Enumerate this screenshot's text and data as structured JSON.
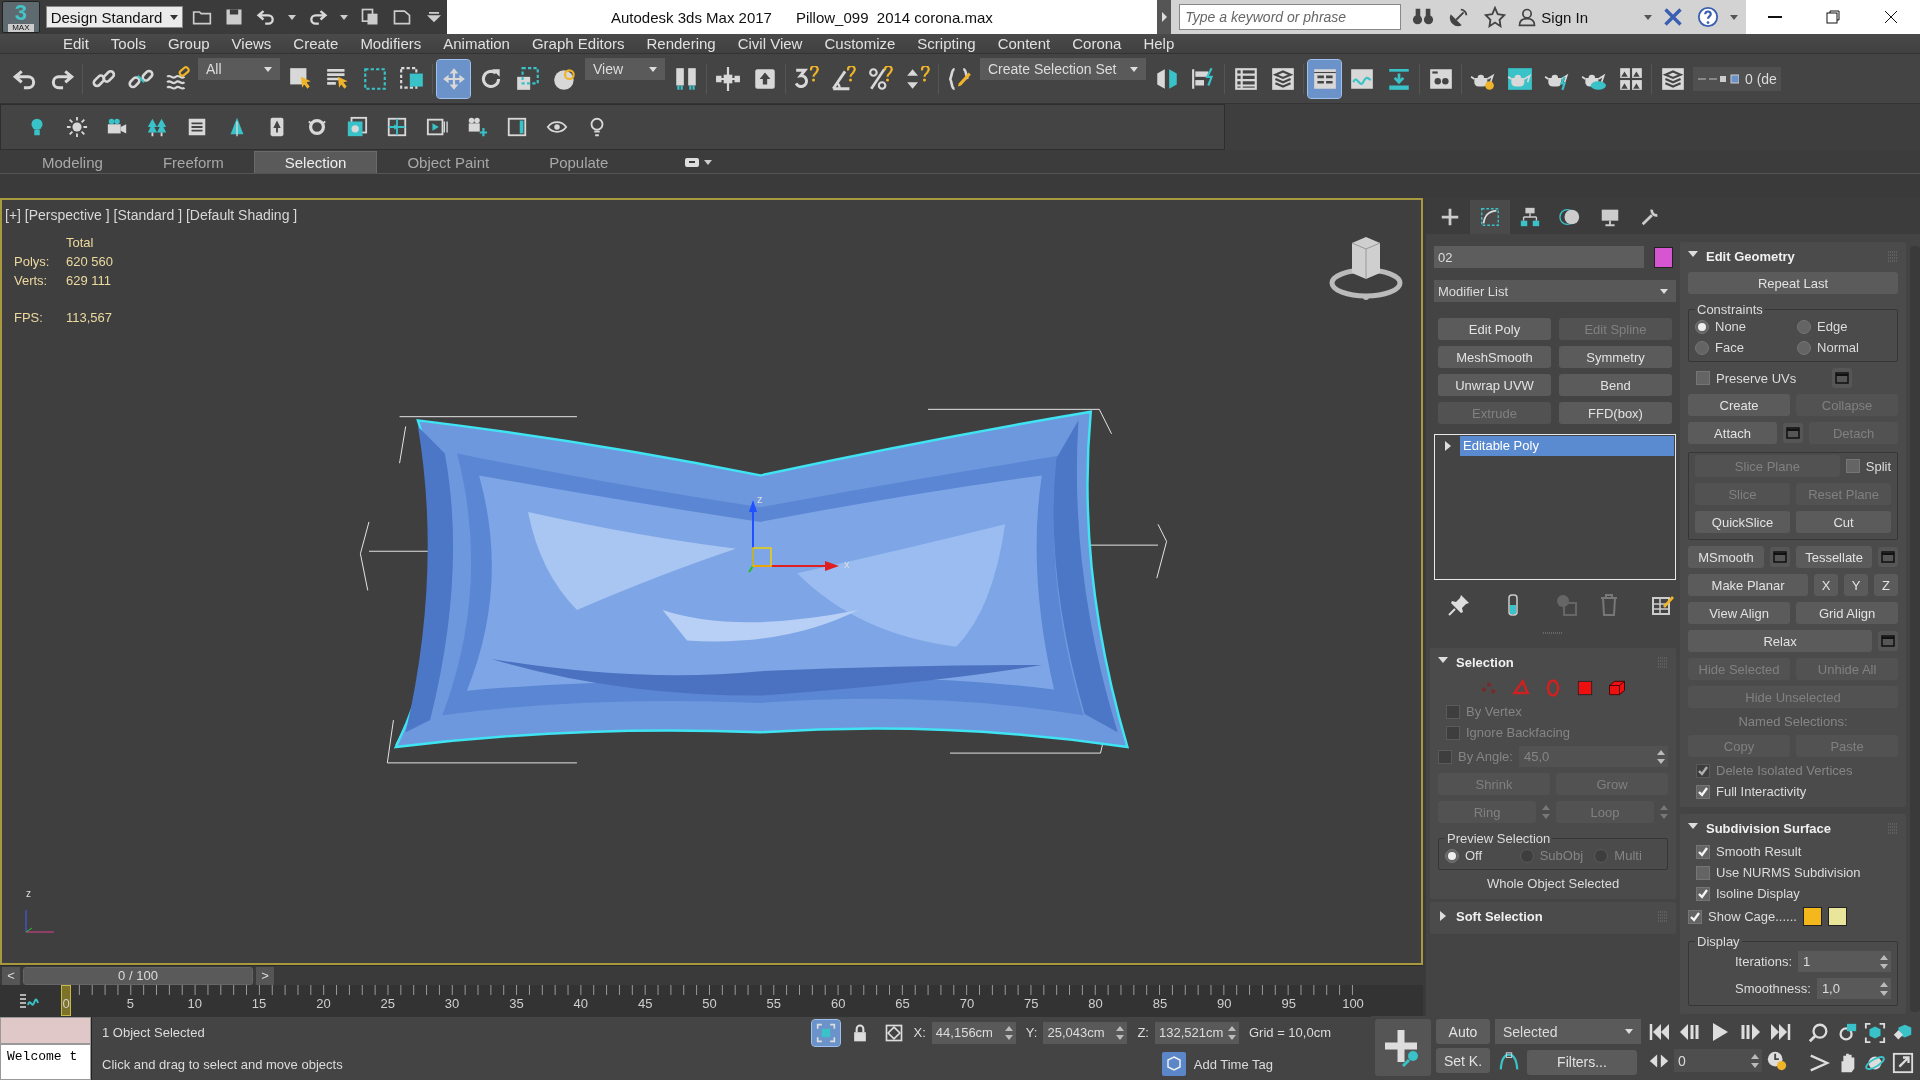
{
  "title_bar": {
    "logo": "3",
    "logo_caption": "MAX",
    "workspace": "Design Standard",
    "app": "Autodesk 3ds Max 2017",
    "file": "Pillow_099  2014 corona.max",
    "search_placeholder": "Type a keyword or phrase",
    "sign_in": "Sign In"
  },
  "menu": [
    "Edit",
    "Tools",
    "Group",
    "Views",
    "Create",
    "Modifiers",
    "Animation",
    "Graph Editors",
    "Rendering",
    "Civil View",
    "Customize",
    "Scripting",
    "Content",
    "Corona",
    "Help"
  ],
  "main_toolbar": [
    {
      "kind": "undo",
      "selected": false
    },
    {
      "kind": "redo",
      "selected": false
    },
    {
      "kind": "separator"
    },
    {
      "kind": "link",
      "selected": false
    },
    {
      "kind": "unlink",
      "selected": false
    },
    {
      "kind": "bind",
      "selected": false
    },
    {
      "kind": "dropdown",
      "label": "All"
    },
    {
      "kind": "select",
      "selected": false
    },
    {
      "kind": "select-name",
      "selected": false
    },
    {
      "kind": "rect-region",
      "selected": false
    },
    {
      "kind": "window-crossing",
      "selected": false
    },
    {
      "kind": "separator"
    },
    {
      "kind": "move",
      "selected": true
    },
    {
      "kind": "rotate",
      "selected": false
    },
    {
      "kind": "scale",
      "selected": false
    },
    {
      "kind": "place",
      "selected": false
    },
    {
      "kind": "dropdown",
      "label": "View"
    },
    {
      "kind": "pivot",
      "selected": false
    },
    {
      "kind": "separator"
    },
    {
      "kind": "manipulate",
      "selected": false
    },
    {
      "kind": "shortcut",
      "selected": false
    },
    {
      "kind": "separator"
    },
    {
      "kind": "snap",
      "selected": false
    },
    {
      "kind": "angle-snap",
      "selected": false
    },
    {
      "kind": "percent-snap",
      "selected": false
    },
    {
      "kind": "spinner-snap",
      "selected": false
    },
    {
      "kind": "separator"
    },
    {
      "kind": "named-sel",
      "selected": false
    },
    {
      "kind": "dropdown",
      "label": "Create Selection Set"
    },
    {
      "kind": "mirror",
      "selected": false
    },
    {
      "kind": "align",
      "selected": false
    },
    {
      "kind": "separator"
    },
    {
      "kind": "scene-explorer",
      "selected": false
    },
    {
      "kind": "layer-explorer",
      "selected": false
    },
    {
      "kind": "separator"
    },
    {
      "kind": "ribbon",
      "selected": true
    },
    {
      "kind": "curve-editor",
      "selected": false
    },
    {
      "kind": "schematic",
      "selected": false
    },
    {
      "kind": "separator"
    },
    {
      "kind": "material",
      "selected": false
    },
    {
      "kind": "separator"
    },
    {
      "kind": "render-setup",
      "selected": false
    },
    {
      "kind": "frame-window",
      "selected": false
    },
    {
      "kind": "render",
      "selected": false
    },
    {
      "kind": "cloud",
      "selected": false
    },
    {
      "kind": "a360",
      "selected": false
    },
    {
      "kind": "separator"
    },
    {
      "kind": "layers",
      "selected": false
    },
    {
      "kind": "layer-dropdown",
      "label": "0 (de"
    }
  ],
  "corona_toolbar": [
    {
      "kind": "light"
    },
    {
      "kind": "sun"
    },
    {
      "kind": "camera"
    },
    {
      "kind": "trees"
    },
    {
      "kind": "list"
    },
    {
      "kind": "tree"
    },
    {
      "kind": "card"
    },
    {
      "kind": "ring"
    },
    {
      "kind": "images"
    },
    {
      "kind": "frame"
    },
    {
      "kind": "play"
    },
    {
      "kind": "camera-plus"
    },
    {
      "kind": "panel"
    },
    {
      "kind": "eye"
    },
    {
      "kind": "bulb"
    }
  ],
  "ribbon_tabs": [
    {
      "label": "Modeling",
      "selected": false
    },
    {
      "label": "Freeform",
      "selected": false
    },
    {
      "label": "Selection",
      "selected": true
    },
    {
      "label": "Object Paint",
      "selected": false
    },
    {
      "label": "Populate",
      "selected": false
    }
  ],
  "viewport": {
    "label": "[+] [Perspective ] [Standard ] [Default Shading ]",
    "stats_header": "Total",
    "stats": [
      {
        "label": "Polys:",
        "value": "620 560"
      },
      {
        "label": "Verts:",
        "value": "629 111"
      }
    ],
    "fps": {
      "label": "FPS:",
      "value": "113,567"
    },
    "gizmo_labels": [
      "z",
      "x"
    ],
    "corner_axis_label": "z",
    "object": {
      "kind": "picture"
    }
  },
  "command_panel": {
    "tabs": [
      {
        "kind": "create",
        "selected": false
      },
      {
        "kind": "modify",
        "selected": true
      },
      {
        "kind": "hierarchy",
        "selected": false
      },
      {
        "kind": "motion",
        "selected": false
      },
      {
        "kind": "display",
        "selected": false
      },
      {
        "kind": "utilities",
        "selected": false
      }
    ],
    "object_name": "02",
    "object_swatch": {
      "color": "#d655d0"
    },
    "modifier_list": "Modifier List",
    "modifier_buttons": [
      {
        "label": "Edit Poly",
        "disabled": false
      },
      {
        "label": "Edit Spline",
        "disabled": true
      },
      {
        "label": "MeshSmooth",
        "disabled": false
      },
      {
        "label": "Symmetry",
        "disabled": false
      },
      {
        "label": "Unwrap UVW",
        "disabled": false
      },
      {
        "label": "Bend",
        "disabled": false
      },
      {
        "label": "Extrude",
        "disabled": true
      },
      {
        "label": "FFD(box)",
        "disabled": false
      }
    ],
    "stack": [
      {
        "label": "Editable Poly",
        "selected": true
      }
    ],
    "left_rollouts": [
      {
        "title": "Selection",
        "expanded": true,
        "items": [
          {
            "kind": "row",
            "cells": [
              {
                "kind": "vertex",
                "disabled": true
              },
              {
                "kind": "edge",
                "disabled": true
              },
              {
                "kind": "border",
                "disabled": true
              },
              {
                "kind": "polygon",
                "disabled": false
              },
              {
                "kind": "element",
                "disabled": false
              }
            ]
          },
          {
            "kind": "row",
            "cells": [
              {
                "kind": "checkbox",
                "label": "By Vertex",
                "checked": false,
                "disabled": true
              }
            ]
          },
          {
            "kind": "row",
            "cells": [
              {
                "kind": "checkbox",
                "label": "Ignore Backfacing",
                "checked": false,
                "disabled": true
              }
            ]
          },
          {
            "kind": "row",
            "cells": [
              {
                "kind": "checkbox",
                "label": "By Angle:",
                "checked": false,
                "disabled": true
              },
              {
                "kind": "spinner",
                "value": "45,0",
                "disabled": true
              }
            ]
          },
          {
            "kind": "row",
            "cells": [
              {
                "kind": "button",
                "label": "Shrink",
                "disabled": true
              },
              {
                "kind": "button",
                "label": "Grow",
                "disabled": true
              }
            ]
          },
          {
            "kind": "row",
            "cells": [
              {
                "kind": "button",
                "label": "Ring",
                "disabled": true,
                "stepper": true
              },
              {
                "kind": "button",
                "label": "Loop",
                "disabled": true,
                "stepper": true
              }
            ]
          },
          {
            "kind": "group",
            "title": "Preview Selection",
            "items": [
              {
                "kind": "radios",
                "options": [
                  {
                    "label": "Off",
                    "selected": true,
                    "disabled": false
                  },
                  {
                    "label": "SubObj",
                    "selected": false,
                    "disabled": true
                  },
                  {
                    "label": "Multi",
                    "selected": false,
                    "disabled": true
                  }
                ]
              }
            ]
          },
          {
            "kind": "row",
            "cells": [
              {
                "kind": "text",
                "text": "Whole Object Selected",
                "disabled": false
              }
            ]
          }
        ]
      },
      {
        "title": "Soft Selection",
        "expanded": false
      }
    ],
    "right_rollouts": [
      {
        "title": "Edit Geometry",
        "expanded": true,
        "items": [
          {
            "kind": "row",
            "cells": [
              {
                "kind": "button",
                "label": "Repeat Last",
                "disabled": false
              }
            ]
          },
          {
            "kind": "group",
            "title": "Constraints",
            "items": [
              {
                "kind": "radios",
                "options": [
                  {
                    "label": "None",
                    "selected": true,
                    "disabled": false
                  },
                  {
                    "label": "Edge",
                    "selected": false,
                    "disabled": false
                  },
                  {
                    "label": "Face",
                    "selected": false,
                    "disabled": false
                  },
                  {
                    "label": "Normal",
                    "selected": false,
                    "disabled": false
                  }
                ]
              }
            ]
          },
          {
            "kind": "row",
            "cells": [
              {
                "kind": "checkbox",
                "label": "Preserve UVs",
                "checked": false,
                "disabled": false,
                "options": true
              }
            ]
          },
          {
            "kind": "row",
            "cells": [
              {
                "kind": "button",
                "label": "Create",
                "disabled": false
              },
              {
                "kind": "button",
                "label": "Collapse",
                "disabled": true
              }
            ]
          },
          {
            "kind": "row",
            "cells": [
              {
                "kind": "button",
                "label": "Attach",
                "disabled": false,
                "options": true
              },
              {
                "kind": "button",
                "label": "Detach",
                "disabled": true
              }
            ]
          },
          {
            "kind": "group",
            "items": [
              {
                "kind": "row",
                "cells": [
                  {
                    "kind": "button",
                    "label": "Slice Plane",
                    "disabled": true
                  },
                  {
                    "kind": "checkbox",
                    "label": "Split",
                    "checked": false,
                    "disabled": false
                  }
                ]
              },
              {
                "kind": "row",
                "cells": [
                  {
                    "kind": "button",
                    "label": "Slice",
                    "disabled": true
                  },
                  {
                    "kind": "button",
                    "label": "Reset Plane",
                    "disabled": true
                  }
                ]
              },
              {
                "kind": "row",
                "cells": [
                  {
                    "kind": "button",
                    "label": "QuickSlice",
                    "disabled": false
                  },
                  {
                    "kind": "button",
                    "label": "Cut",
                    "disabled": false
                  }
                ]
              }
            ]
          },
          {
            "kind": "row",
            "cells": [
              {
                "kind": "button",
                "label": "MSmooth",
                "disabled": false,
                "options": true
              },
              {
                "kind": "button",
                "label": "Tessellate",
                "disabled": false,
                "options": true
              }
            ]
          },
          {
            "kind": "row",
            "cells": [
              {
                "kind": "button",
                "label": "Make Planar",
                "disabled": false
              },
              {
                "kind": "button",
                "label": "X",
                "disabled": false
              },
              {
                "kind": "button",
                "label": "Y",
                "disabled": false
              },
              {
                "kind": "button",
                "label": "Z",
                "disabled": false
              }
            ]
          },
          {
            "kind": "row",
            "cells": [
              {
                "kind": "button",
                "label": "View Align",
                "disabled": false
              },
              {
                "kind": "button",
                "label": "Grid Align",
                "disabled": false
              }
            ]
          },
          {
            "kind": "row",
            "cells": [
              {
                "kind": "button",
                "label": "Relax",
                "disabled": false,
                "options": true
              }
            ]
          },
          {
            "kind": "row",
            "cells": [
              {
                "kind": "button",
                "label": "Hide Selected",
                "disabled": true
              },
              {
                "kind": "button",
                "label": "Unhide All",
                "disabled": true
              }
            ]
          },
          {
            "kind": "row",
            "cells": [
              {
                "kind": "button",
                "label": "Hide Unselected",
                "disabled": true
              }
            ]
          },
          {
            "kind": "row",
            "cells": [
              {
                "kind": "text",
                "text": "Named Selections:",
                "disabled": true
              }
            ]
          },
          {
            "kind": "row",
            "cells": [
              {
                "kind": "button",
                "label": "Copy",
                "disabled": true
              },
              {
                "kind": "button",
                "label": "Paste",
                "disabled": true
              }
            ]
          },
          {
            "kind": "row",
            "cells": [
              {
                "kind": "checkbox",
                "label": "Delete Isolated Vertices",
                "checked": true,
                "disabled": true
              }
            ]
          },
          {
            "kind": "row",
            "cells": [
              {
                "kind": "checkbox",
                "label": "Full Interactivity",
                "checked": true,
                "disabled": false
              }
            ]
          }
        ]
      },
      {
        "title": "Subdivision Surface",
        "expanded": true,
        "items": [
          {
            "kind": "row",
            "cells": [
              {
                "kind": "checkbox",
                "label": "Smooth Result",
                "checked": true,
                "disabled": false
              }
            ]
          },
          {
            "kind": "row",
            "cells": [
              {
                "kind": "checkbox",
                "label": "Use NURMS Subdivision",
                "checked": false,
                "disabled": false
              }
            ]
          },
          {
            "kind": "row",
            "cells": [
              {
                "kind": "checkbox",
                "label": "Isoline Display",
                "checked": true,
                "disabled": false
              }
            ]
          },
          {
            "kind": "row",
            "cells": [
              {
                "kind": "checkbox",
                "label": "Show Cage......",
                "checked": true,
                "disabled": false
              },
              {
                "kind": "swatch",
                "color": "#f5b81c"
              },
              {
                "kind": "swatch",
                "color": "#e9e59a"
              }
            ]
          },
          {
            "kind": "group",
            "title": "Display",
            "items": [
              {
                "kind": "row",
                "cells": [
                  {
                    "kind": "spinner",
                    "label": "Iterations:",
                    "value": "1",
                    "disabled": false
                  }
                ]
              },
              {
                "kind": "row",
                "cells": [
                  {
                    "kind": "spinner",
                    "label": "Smoothness:",
                    "value": "1,0",
                    "disabled": false
                  }
                ]
              }
            ]
          }
        ]
      }
    ]
  },
  "time_slider": {
    "prev": "<",
    "label": "0 / 100",
    "next": ">",
    "level": 0
  },
  "track_bar": {
    "ticks": [
      "0",
      "5",
      "10",
      "15",
      "20",
      "25",
      "30",
      "35",
      "40",
      "45",
      "50",
      "55",
      "60",
      "65",
      "70",
      "75",
      "80",
      "85",
      "90",
      "95",
      "100"
    ]
  },
  "status": {
    "listener_output": "Welcome t",
    "selection": "1 Object Selected",
    "prompt": "Click and drag to select and move objects",
    "toggles": [
      {
        "kind": "isolate",
        "on": true
      },
      {
        "kind": "lock",
        "on": false
      },
      {
        "kind": "absolute",
        "on": false
      }
    ],
    "coords": [
      {
        "label": "X:",
        "value": "44,156cm"
      },
      {
        "label": "Y:",
        "value": "25,043cm"
      },
      {
        "label": "Z:",
        "value": "132,521cm"
      }
    ],
    "grid": "Grid = 10,0cm",
    "time_tag": "Add Time Tag"
  },
  "animation": {
    "auto_key": "Auto",
    "key_filter": "Selected",
    "set_key": "Set K.",
    "filters": "Filters...",
    "frame": "0"
  }
}
